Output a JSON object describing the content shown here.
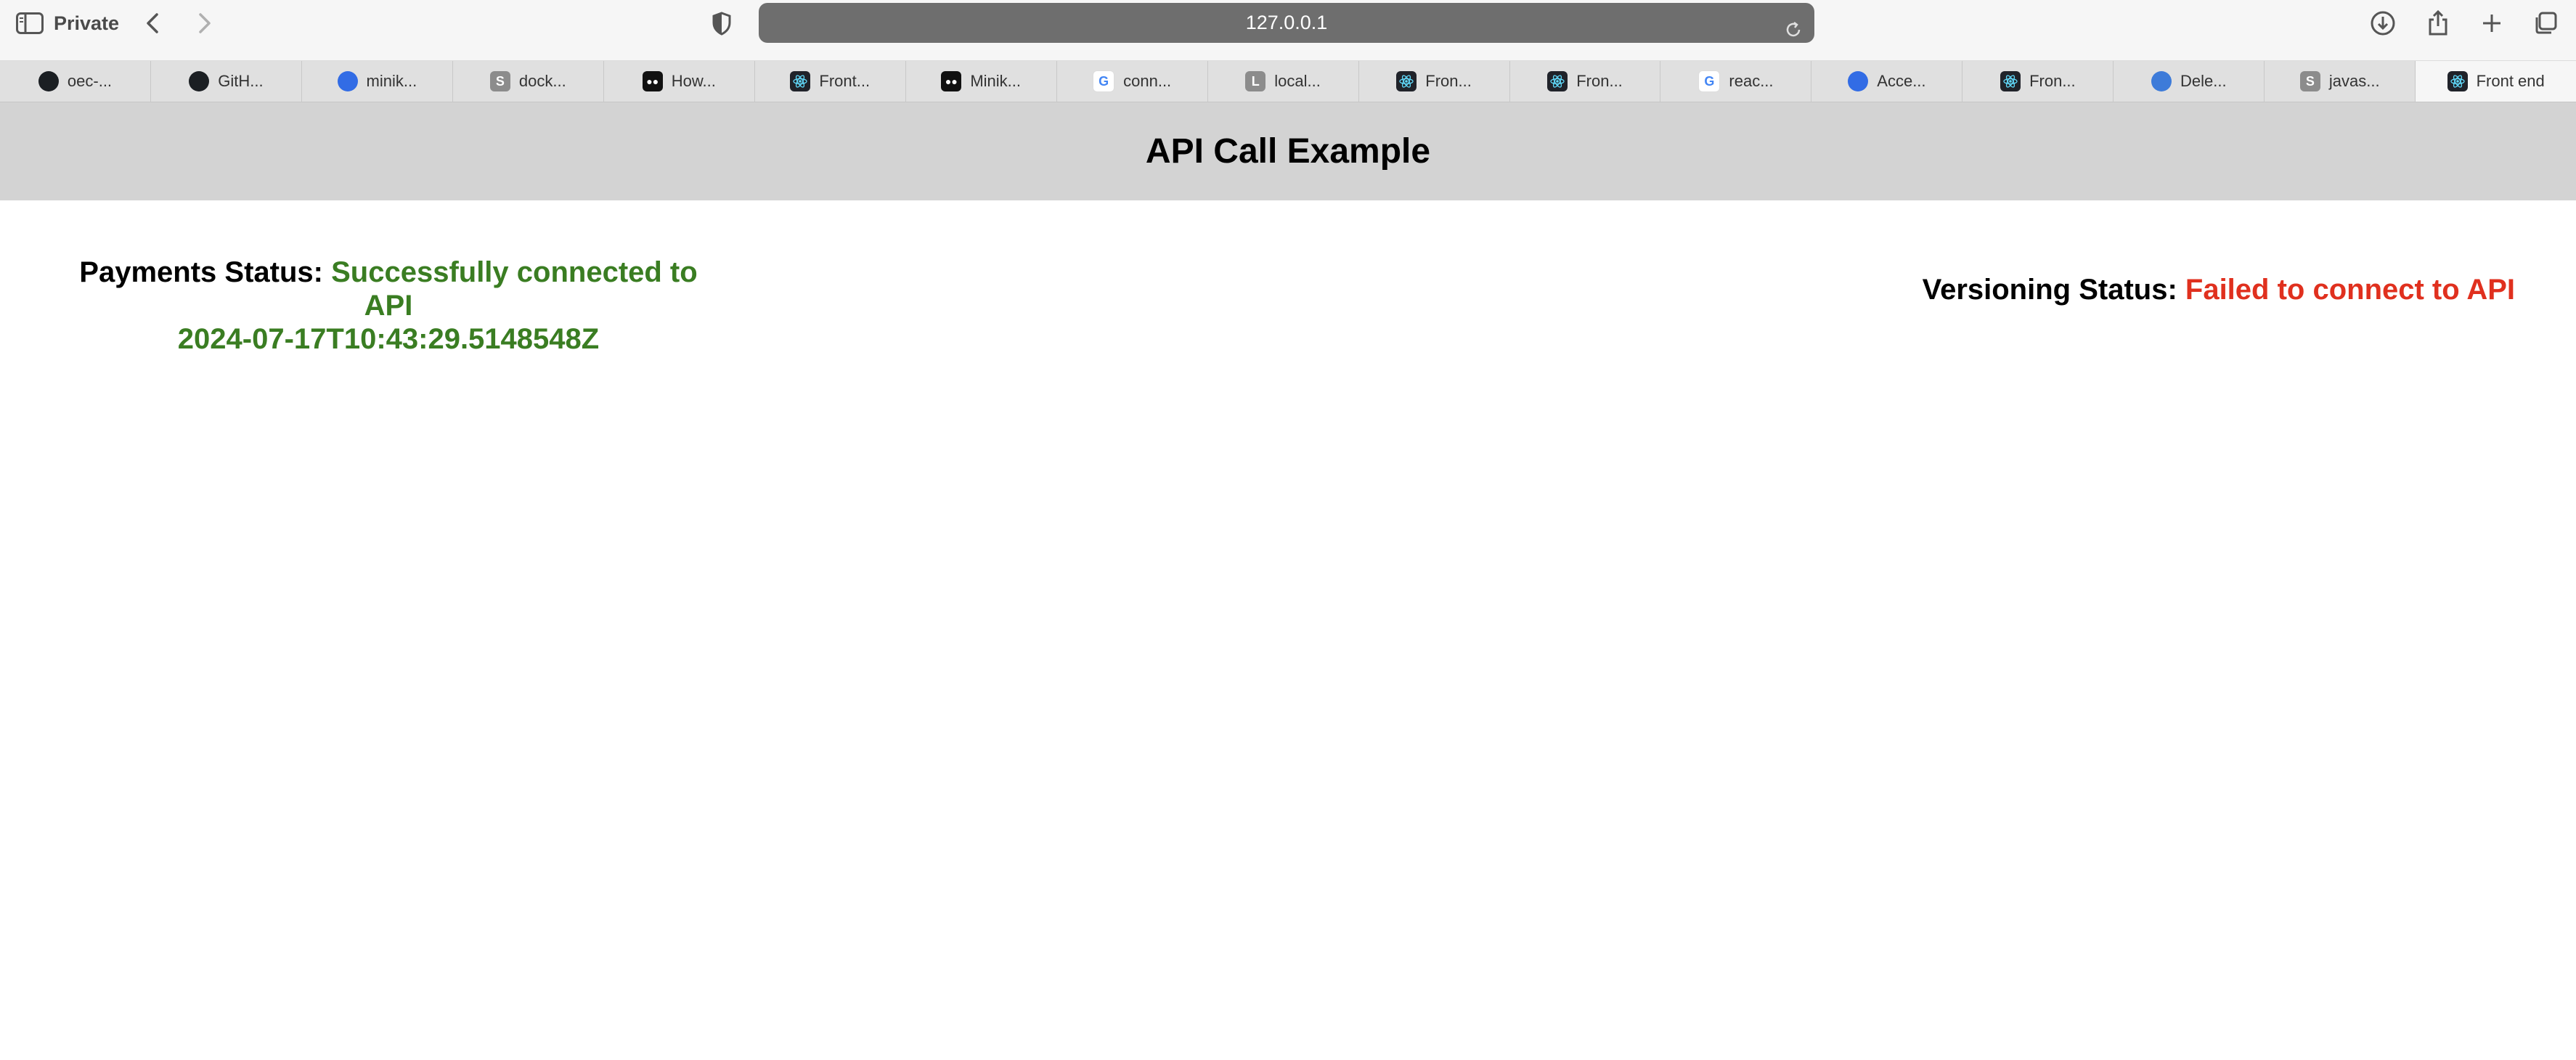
{
  "browser": {
    "private_label": "Private",
    "url": "127.0.0.1"
  },
  "tabs": [
    {
      "label": "oec-...",
      "icon": "github-icon"
    },
    {
      "label": "GitH...",
      "icon": "github-icon"
    },
    {
      "label": "minik...",
      "icon": "minikube-icon"
    },
    {
      "label": "dock...",
      "icon": "s-icon"
    },
    {
      "label": "How...",
      "icon": "medium-icon"
    },
    {
      "label": "Front...",
      "icon": "react-icon"
    },
    {
      "label": "Minik...",
      "icon": "medium-icon"
    },
    {
      "label": "conn...",
      "icon": "google-icon"
    },
    {
      "label": "local...",
      "icon": "l-icon"
    },
    {
      "label": "Fron...",
      "icon": "react-icon"
    },
    {
      "label": "Fron...",
      "icon": "react-icon"
    },
    {
      "label": "reac...",
      "icon": "google-icon"
    },
    {
      "label": "Acce...",
      "icon": "minikube-icon"
    },
    {
      "label": "Fron...",
      "icon": "react-icon"
    },
    {
      "label": "Dele...",
      "icon": "globe-icon"
    },
    {
      "label": "javas...",
      "icon": "s-icon"
    },
    {
      "label": "Front end",
      "icon": "react-icon",
      "active": true
    }
  ],
  "page": {
    "title": "API Call Example",
    "payments": {
      "label": "Payments Status:",
      "status": "Successfully connected to API",
      "timestamp": "2024-07-17T10:43:29.5148548Z"
    },
    "versioning": {
      "label": "Versioning Status:",
      "status": "Failed to connect to API"
    }
  },
  "colors": {
    "success": "#3a7d22",
    "failure": "#e0301e",
    "header_bg": "#d3d3d3"
  }
}
